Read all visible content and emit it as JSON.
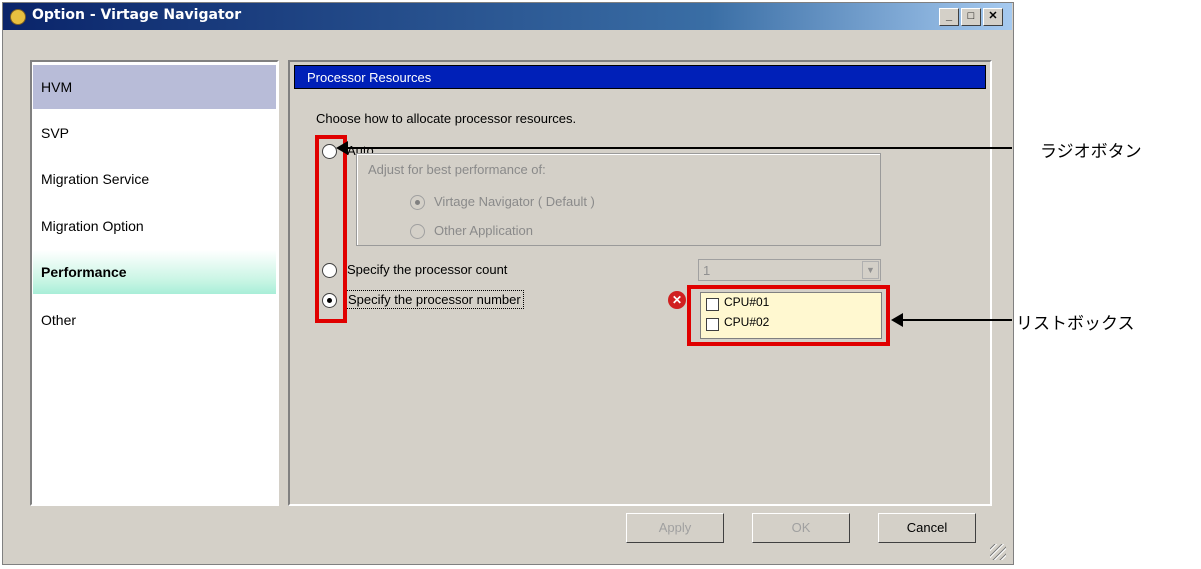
{
  "window": {
    "title": "Option - Virtage Navigator"
  },
  "sidebar": {
    "items": [
      {
        "label": "HVM"
      },
      {
        "label": "SVP"
      },
      {
        "label": "Migration Service"
      },
      {
        "label": "Migration Option"
      },
      {
        "label": "Performance"
      },
      {
        "label": "Other"
      }
    ]
  },
  "panel": {
    "header": "Processor Resources",
    "instruction": "Choose how to allocate processor resources.",
    "auto": {
      "label": "Auto",
      "group_label": "Adjust for best performance of:",
      "options": [
        "Virtage Navigator ( Default )",
        "Other Application"
      ]
    },
    "count": {
      "label": "Specify the processor count",
      "value": "1"
    },
    "number": {
      "label": "Specify the processor number",
      "cpus": [
        "CPU#01",
        "CPU#02"
      ]
    }
  },
  "buttons": {
    "apply": "Apply",
    "ok": "OK",
    "cancel": "Cancel"
  },
  "annotations": {
    "radio": "ラジオボタン",
    "listbox": "リストボックス"
  },
  "colors": {
    "title_bar": "#0a246a",
    "section_header": "#0020b8",
    "highlight": "#e00000",
    "listbox_bg": "#fff8d0"
  }
}
